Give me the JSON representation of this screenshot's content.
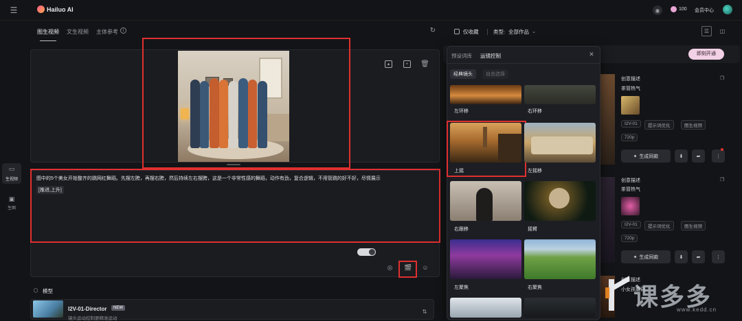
{
  "topbar": {
    "brand": "Hailuo AI",
    "credits": "100",
    "member": "会员中心"
  },
  "leftnav": [
    {
      "label": "生视频"
    },
    {
      "label": "生图"
    }
  ],
  "main": {
    "tabs": [
      "图生视频",
      "文生视频",
      "主体参考"
    ],
    "prompt": "图中的5个美女开始整齐的跳网红舞蹈。先摆左胯，再摆右胯，然后持续左右摆胯，这是一个非常性感的舞蹈，动作有劲，复合逻辑，不用管跳的好不好，尽情展示",
    "camera_tag": "[推进,上升]",
    "model_section": "模型",
    "model_name": "I2V-01-Director",
    "model_badge": "NEW",
    "model_desc": "镜头运动控制更精准运动"
  },
  "filters": {
    "fav_only": "仅收藏",
    "type_label": "类型:",
    "type_value": "全部作品"
  },
  "popup": {
    "tabs": [
      "预设词库",
      "运镜控制"
    ],
    "subtabs": [
      "经典镜头",
      "自由选择"
    ],
    "items": [
      {
        "label": "左环移"
      },
      {
        "label": "右环移"
      },
      {
        "label": "上摇"
      },
      {
        "label": "左摇移"
      },
      {
        "label": "右跟移"
      },
      {
        "label": "摇臂"
      },
      {
        "label": "左聚焦"
      },
      {
        "label": "右聚焦"
      }
    ]
  },
  "right": {
    "open_button": "即刻开通",
    "cards": [
      {
        "title": "创意描述",
        "subtitle": "茶冒热气",
        "tags": [
          "I2V-01",
          "提示词优化",
          "图生视频",
          "720p"
        ],
        "generate": "生成同款"
      },
      {
        "title": "创意描述",
        "subtitle": "茶冒热气",
        "tags": [
          "I2V-01",
          "提示词优化",
          "图生视频",
          "720p"
        ],
        "generate": "生成同款"
      },
      {
        "title": "创意描述",
        "subtitle": "小女孩蘑菇",
        "tags": [],
        "generate": ""
      }
    ]
  },
  "watermark": {
    "text": "课多多",
    "url": "www.kedd.cn"
  },
  "colors": {
    "accent": "#e03030",
    "open_btn": "#f2d0e6",
    "bg": "#131417"
  }
}
